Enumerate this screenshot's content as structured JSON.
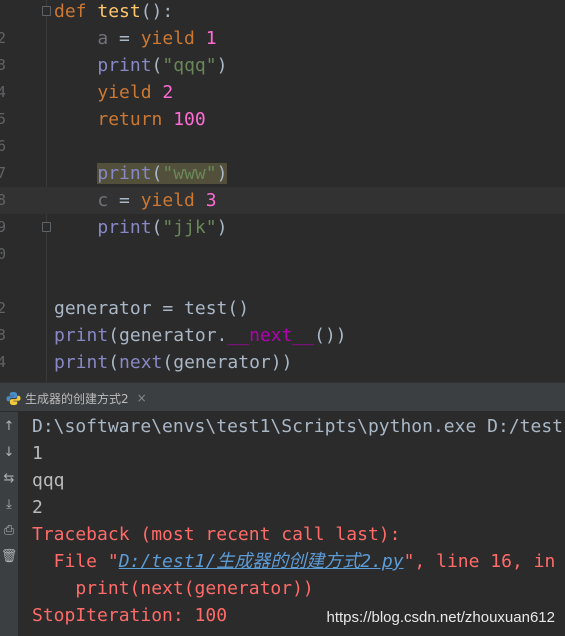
{
  "editor": {
    "line_numbers": [
      "",
      "2",
      "3",
      "4",
      "5",
      "6",
      "7",
      "8",
      "9",
      "0",
      "",
      "2",
      "3",
      "4"
    ],
    "lines": [
      {
        "tokens": [
          [
            "kw",
            "def "
          ],
          [
            "def-name",
            "test"
          ],
          [
            "plain",
            "():"
          ]
        ]
      },
      {
        "tokens": [
          [
            "var-unused",
            "    a"
          ],
          [
            "plain",
            " = "
          ],
          [
            "kw",
            "yield "
          ],
          [
            "num",
            "1"
          ]
        ]
      },
      {
        "tokens": [
          [
            "plain",
            "    "
          ],
          [
            "bi",
            "print"
          ],
          [
            "plain",
            "("
          ],
          [
            "str",
            "\"qqq\""
          ],
          [
            "plain",
            ")"
          ]
        ]
      },
      {
        "tokens": [
          [
            "plain",
            "    "
          ],
          [
            "kw",
            "yield "
          ],
          [
            "num",
            "2"
          ]
        ]
      },
      {
        "tokens": [
          [
            "plain",
            "    "
          ],
          [
            "kw",
            "return "
          ],
          [
            "num",
            "100"
          ]
        ]
      },
      {
        "tokens": []
      },
      {
        "tokens": [
          [
            "plain",
            "    "
          ],
          [
            "bi",
            "print"
          ],
          [
            "plain",
            "("
          ],
          [
            "str",
            "\"www\""
          ],
          [
            "plain",
            ")"
          ]
        ]
      },
      {
        "tokens": [
          [
            "var-unused",
            "    c"
          ],
          [
            "plain",
            " = "
          ],
          [
            "kw",
            "yield "
          ],
          [
            "num",
            "3"
          ]
        ]
      },
      {
        "tokens": [
          [
            "plain",
            "    "
          ],
          [
            "bi",
            "print"
          ],
          [
            "plain",
            "("
          ],
          [
            "str",
            "\"jjk\""
          ],
          [
            "plain",
            ")"
          ]
        ]
      },
      {
        "tokens": []
      },
      {
        "tokens": []
      },
      {
        "tokens": [
          [
            "plain",
            "generator = test()"
          ]
        ]
      },
      {
        "tokens": [
          [
            "bi",
            "print"
          ],
          [
            "plain",
            "(generator."
          ],
          [
            "dunder",
            "__next__"
          ],
          [
            "plain",
            "())"
          ]
        ]
      },
      {
        "tokens": [
          [
            "bi",
            "print"
          ],
          [
            "plain",
            "("
          ],
          [
            "bi",
            "next"
          ],
          [
            "plain",
            "(generator))"
          ]
        ]
      }
    ]
  },
  "run_tab": {
    "label": "生成器的创建方式2",
    "close": "×"
  },
  "console": {
    "command": "D:\\software\\envs\\test1\\Scripts\\python.exe D:/test",
    "out1": "1",
    "out2": "qqq",
    "out3": "2",
    "traceback": "Traceback (most recent call last):",
    "file_prefix": "  File \"",
    "file_link": "D:/test1/生成器的创建方式2.py",
    "file_suffix": "\", line 16, in",
    "code_line": "    print(next(generator))",
    "stop": "StopIteration: 100"
  },
  "watermark": "https://blog.csdn.net/zhouxuan612",
  "icons": [
    "up-arrow-icon",
    "down-arrow-icon",
    "soft-wrap-icon",
    "scroll-to-end-icon",
    "print-icon",
    "trash-icon",
    "python-icon"
  ]
}
